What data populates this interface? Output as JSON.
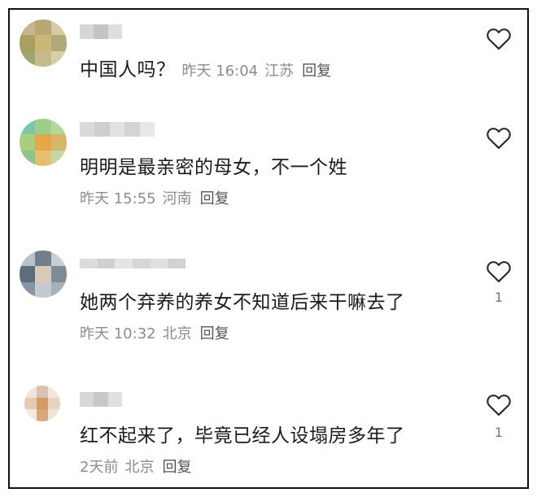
{
  "comments": [
    {
      "text": "中国人吗？",
      "time": "昨天 16:04",
      "location": "江苏",
      "reply_label": "回复",
      "likes": ""
    },
    {
      "text": "明明是最亲密的母女，不一个姓",
      "time": "昨天 15:55",
      "location": "河南",
      "reply_label": "回复",
      "likes": ""
    },
    {
      "text": "她两个弃养的养女不知道后来干嘛去了",
      "time": "昨天 10:32",
      "location": "北京",
      "reply_label": "回复",
      "likes": "1"
    },
    {
      "text": "红不起来了，毕竟已经人设塌房多年了",
      "time": "2天前",
      "location": "北京",
      "reply_label": "回复",
      "likes": "1"
    }
  ],
  "icons": {
    "like": "heart-outline-icon"
  },
  "colors": {
    "text": "#1b1b1b",
    "meta": "#8c8c8c",
    "border": "#111111"
  }
}
